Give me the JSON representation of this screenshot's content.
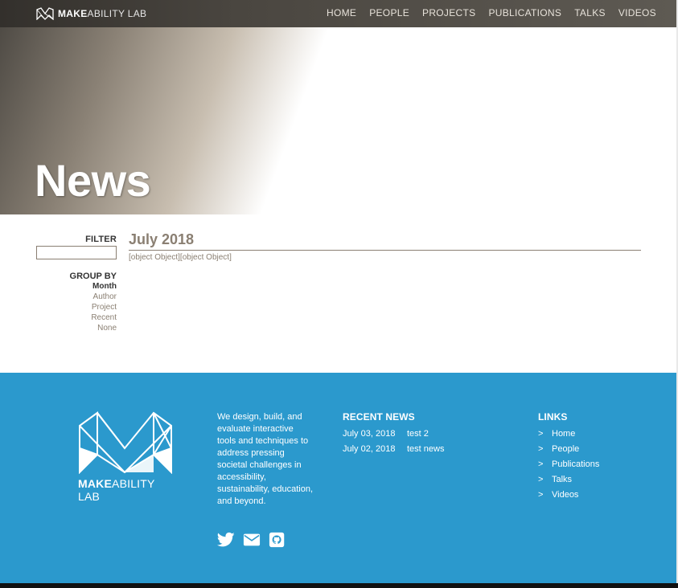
{
  "brand": {
    "bold": "MAKE",
    "light": "ABILITY LAB"
  },
  "nav": {
    "items": [
      {
        "label": "HOME"
      },
      {
        "label": "PEOPLE"
      },
      {
        "label": "PROJECTS"
      },
      {
        "label": "PUBLICATIONS"
      },
      {
        "label": "TALKS"
      },
      {
        "label": "VIDEOS"
      }
    ]
  },
  "hero": {
    "title": "News"
  },
  "sidebar": {
    "filter_label": "FILTER",
    "filter_value": "",
    "groupby_label": "GROUP BY",
    "options": [
      {
        "label": "Month",
        "active": true
      },
      {
        "label": "Author",
        "active": false
      },
      {
        "label": "Project",
        "active": false
      },
      {
        "label": "Recent",
        "active": false
      },
      {
        "label": "None",
        "active": false
      }
    ]
  },
  "main": {
    "month_heading": "July 2018",
    "content_text": "[object Object][object Object]"
  },
  "footer": {
    "logo_text_bold": "MAKE",
    "logo_text_light": "ABILITY LAB",
    "about": "We design, build, and evaluate interactive tools and techniques to address pressing societal challenges in accessibility, sustainability, education, and beyond.",
    "social_icons": [
      "twitter-icon",
      "envelope-icon",
      "github-icon"
    ],
    "recent_news": {
      "heading": "RECENT NEWS",
      "items": [
        {
          "date": "July 03, 2018",
          "title": "test 2"
        },
        {
          "date": "July 02, 2018",
          "title": "test news"
        }
      ]
    },
    "links": {
      "heading": "LINKS",
      "chevron": ">",
      "items": [
        {
          "label": "Home"
        },
        {
          "label": "People"
        },
        {
          "label": "Publications"
        },
        {
          "label": "Talks"
        },
        {
          "label": "Videos"
        }
      ]
    }
  },
  "colors": {
    "accent_brown": "#8a7f72",
    "footer_blue": "#2b99cd",
    "nav_dark": "#3d3a35"
  }
}
